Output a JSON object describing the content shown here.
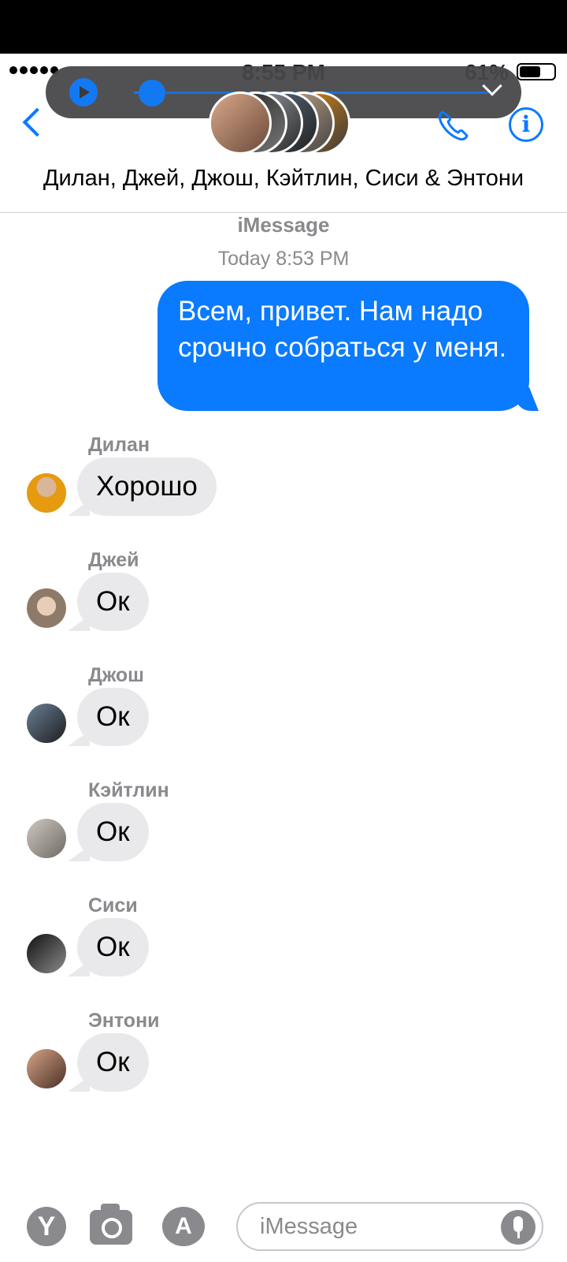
{
  "status_bar": {
    "time": "8:55 PM",
    "battery": "61%",
    "battery_level": 0.61
  },
  "player": {
    "progress": 0.05,
    "play_icon": "play-icon",
    "collapse_icon": "chevron-down-icon"
  },
  "nav": {
    "group_name": "Дилан, Джей, Джош, Кэйтлин, Сиси & Энтони",
    "back_icon": "chevron-left-icon",
    "call_icon": "phone-icon",
    "info_icon": "info-icon",
    "info_glyph": "i"
  },
  "thread": {
    "service": "iMessage",
    "timestamp": "Today 8:53 PM",
    "outgoing": {
      "text": "Всем, привет. Нам надо срочно собраться у меня."
    },
    "incoming": [
      {
        "sender": "Дилан",
        "text": "Хорошо"
      },
      {
        "sender": "Джей",
        "text": "Ок"
      },
      {
        "sender": "Джош",
        "text": "Ок"
      },
      {
        "sender": "Кэйтлин",
        "text": "Ок"
      },
      {
        "sender": "Сиси",
        "text": "Ок"
      },
      {
        "sender": "Энтони",
        "text": "Ок"
      }
    ]
  },
  "composer": {
    "placeholder": "iMessage",
    "left_glyph": "Y",
    "app_glyph": "A"
  },
  "colors": {
    "accent": "#0a7aff",
    "incoming_bubble": "#e9e9eb",
    "secondary_text": "#8a8a8e"
  }
}
